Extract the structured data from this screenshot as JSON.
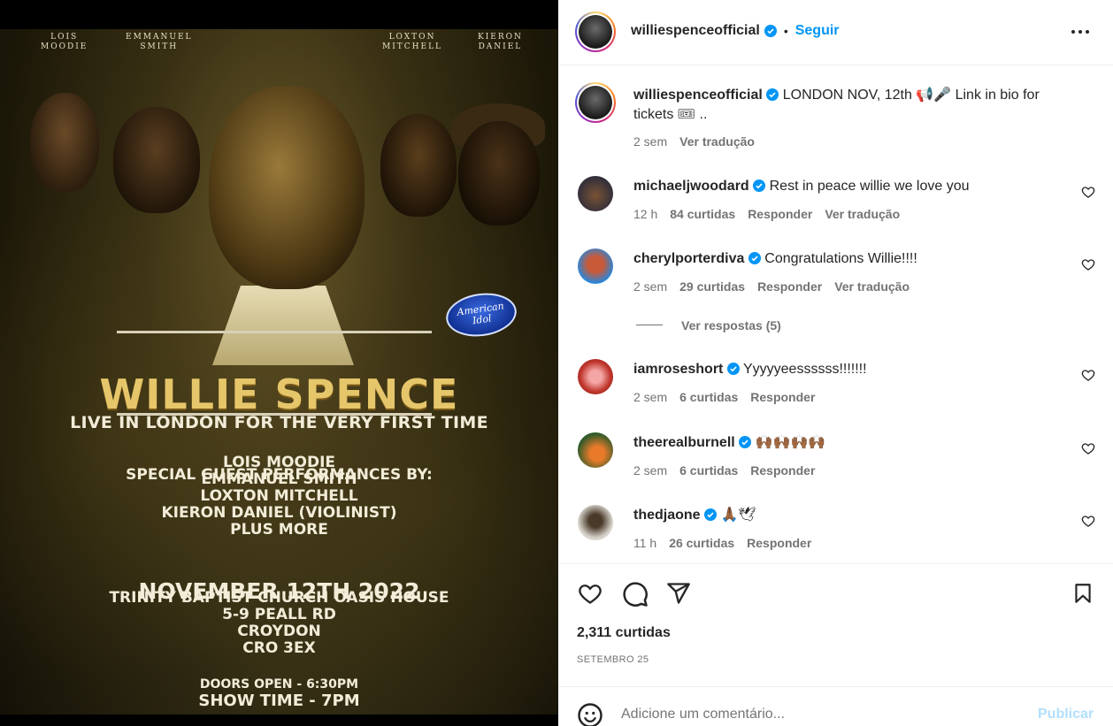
{
  "poster": {
    "guest_labels": [
      {
        "top": "LOIS",
        "bottom": "MOODIE"
      },
      {
        "top": "EMMANUEL",
        "bottom": "SMITH"
      },
      {
        "top": "LOXTON",
        "bottom": "MITCHELL"
      },
      {
        "top": "KIERON",
        "bottom": "DANIEL"
      }
    ],
    "badge_text": "American Idol",
    "title": "WILLIE SPENCE",
    "subtitle": "LIVE IN LONDON FOR THE VERY FIRST TIME",
    "guests_heading": "SPECIAL GUEST PERFORMANCES BY:",
    "guests": [
      "LOIS MOODIE",
      "EMMANUEL SMITH",
      "LOXTON MITCHELL",
      "KIERON DANIEL (VIOLINIST)",
      "PLUS MORE"
    ],
    "date": "NOVEMBER 12TH 2022",
    "venue_lines": [
      "TRINITY BAPTIST CHURCH OASIS HOUSE",
      "5-9 PEALL RD",
      "CROYDON",
      "CRO 3EX"
    ],
    "doors": "DOORS OPEN - 6:30PM",
    "show": "SHOW TIME - 7PM"
  },
  "header": {
    "username": "williespenceofficial",
    "dot": "•",
    "follow_label": "Seguir",
    "more_icon": "more-horizontal-icon"
  },
  "caption": {
    "username": "williespenceofficial",
    "text_line1": "LONDON NOV, 12th 📢🎤 Link in bio for",
    "text_line2": "tickets 🎟 ..",
    "time": "2 sem",
    "translate": "Ver tradução"
  },
  "comments": [
    {
      "username": "michaeljwoodard",
      "text": "Rest in peace willie we love you",
      "time": "12 h",
      "likes": "84 curtidas",
      "reply": "Responder",
      "translate": "Ver tradução"
    },
    {
      "username": "cherylporterdiva",
      "text": "Congratulations Willie!!!!",
      "time": "2 sem",
      "likes": "29 curtidas",
      "reply": "Responder",
      "translate": "Ver tradução",
      "view_replies": "Ver respostas (5)"
    },
    {
      "username": "iamroseshort",
      "text": "Yyyyyeessssss!!!!!!!",
      "time": "2 sem",
      "likes": "6 curtidas",
      "reply": "Responder"
    },
    {
      "username": "theerealburnell",
      "text": "🙌🏾🙌🏾🙌🏾🙌🏾",
      "time": "2 sem",
      "likes": "6 curtidas",
      "reply": "Responder"
    },
    {
      "username": "thedjaone",
      "text": "🙏🏾🕊",
      "time": "11 h",
      "likes": "26 curtidas",
      "reply": "Responder"
    }
  ],
  "footer": {
    "likes": "2,311 curtidas",
    "date": "SETEMBRO 25",
    "comment_placeholder": "Adicione um comentário...",
    "publish_label": "Publicar"
  },
  "colors": {
    "accent_blue": "#0095f6",
    "verified_blue": "#0095f6",
    "publish_disabled": "#b2dffc",
    "poster_gold": "#e6c66a"
  }
}
